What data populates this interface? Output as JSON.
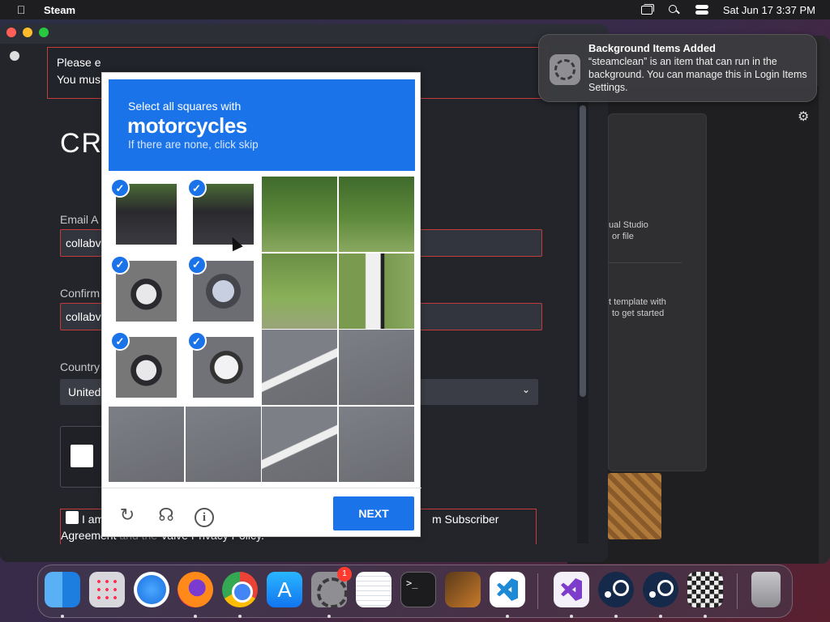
{
  "menubar": {
    "app_name": "Steam",
    "clock": "Sat Jun 17  3:37 PM"
  },
  "notification": {
    "title": "Background Items Added",
    "body": "“steamclean” is an item that can run in the background. You can manage this in Login Items Settings."
  },
  "background_window": {
    "panel_text_1a": "ual Studio",
    "panel_text_1b": "or file",
    "panel_text_2a": "t template with",
    "panel_text_2b": "to get started"
  },
  "steam": {
    "error_line1": "Please e",
    "error_line2": "You mus",
    "page_title": "CRI",
    "email_label": "Email A",
    "email_value": "collabv",
    "confirm_label": "Confirm",
    "confirm_value": "collabv",
    "country_label": "Country",
    "country_value": "United",
    "agree_line1a": "I am",
    "agree_line1b": "m Subscriber",
    "agree_line2a": "Agreement",
    "agree_line2b": " and the ",
    "agree_line2c": "Valve Privacy Policy."
  },
  "recaptcha": {
    "instruction": "Select all squares with",
    "target": "motorcycles",
    "hint": "If there are none, click skip",
    "next_label": "NEXT",
    "tiles": [
      {
        "style": "g-rider",
        "selected": true
      },
      {
        "style": "g-rider",
        "selected": true
      },
      {
        "style": "g-foliage",
        "selected": false
      },
      {
        "style": "g-foliage",
        "selected": false
      },
      {
        "style": "g-scoot",
        "selected": true
      },
      {
        "style": "g-blur",
        "selected": true
      },
      {
        "style": "g-grass",
        "selected": false
      },
      {
        "style": "g-post",
        "selected": false
      },
      {
        "style": "g-scoot",
        "selected": true
      },
      {
        "style": "g-scoot2",
        "selected": true
      },
      {
        "style": "g-roadline",
        "selected": false
      },
      {
        "style": "g-road",
        "selected": false
      },
      {
        "style": "g-road",
        "selected": false
      },
      {
        "style": "g-road",
        "selected": false
      },
      {
        "style": "g-roadline",
        "selected": false
      },
      {
        "style": "g-road",
        "selected": false
      }
    ]
  },
  "dock": {
    "settings_badge": "1",
    "items": [
      "finder-icon",
      "launchpad-icon",
      "safari-icon",
      "firefox-icon",
      "chrome-icon",
      "app-store-icon",
      "system-settings-icon",
      "textedit-icon",
      "terminal-icon",
      "garageband-icon",
      "vscode-icon",
      "visual-studio-icon",
      "steam-icon",
      "steam-icon",
      "chess-icon",
      "trash-icon"
    ]
  }
}
